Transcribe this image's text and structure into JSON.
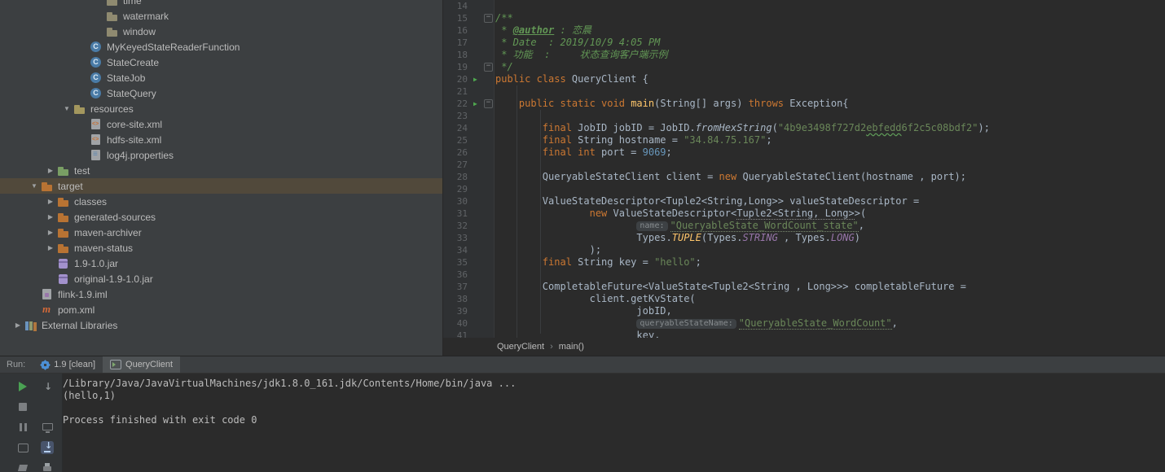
{
  "palette": {
    "editor_bg": "#2b2b2b",
    "panel_bg": "#3c3f41",
    "keyword": "#cc7832",
    "string": "#6a8759",
    "number": "#6897bb",
    "comment": "#629755",
    "method": "#ffc66b",
    "constant": "#9876aa",
    "tree_selection": "#51493b",
    "run_green": "#4aa153"
  },
  "project_tree": {
    "items": [
      {
        "label": "time",
        "type": "folder",
        "indent": 5
      },
      {
        "label": "watermark",
        "type": "folder",
        "indent": 5
      },
      {
        "label": "window",
        "type": "folder",
        "indent": 5
      },
      {
        "label": "MyKeyedStateReaderFunction",
        "type": "class",
        "indent": 4
      },
      {
        "label": "StateCreate",
        "type": "class",
        "indent": 4
      },
      {
        "label": "StateJob",
        "type": "class",
        "indent": 4
      },
      {
        "label": "StateQuery",
        "type": "class",
        "indent": 4
      },
      {
        "label": "resources",
        "type": "folder-resources",
        "indent": 3,
        "arrow": "down"
      },
      {
        "label": "core-site.xml",
        "type": "xml",
        "indent": 4
      },
      {
        "label": "hdfs-site.xml",
        "type": "xml",
        "indent": 4
      },
      {
        "label": "log4j.properties",
        "type": "properties",
        "indent": 4
      },
      {
        "label": "test",
        "type": "folder-test",
        "indent": 2,
        "arrow": "right"
      },
      {
        "label": "target",
        "type": "folder-excluded",
        "indent": 1,
        "arrow": "down",
        "selected": true
      },
      {
        "label": "classes",
        "type": "folder-gen",
        "indent": 2,
        "arrow": "right"
      },
      {
        "label": "generated-sources",
        "type": "folder-gen",
        "indent": 2,
        "arrow": "right"
      },
      {
        "label": "maven-archiver",
        "type": "folder-gen",
        "indent": 2,
        "arrow": "right"
      },
      {
        "label": "maven-status",
        "type": "folder-gen",
        "indent": 2,
        "arrow": "right"
      },
      {
        "label": "1.9-1.0.jar",
        "type": "jar",
        "indent": 2
      },
      {
        "label": "original-1.9-1.0.jar",
        "type": "jar",
        "indent": 2
      },
      {
        "label": "flink-1.9.iml",
        "type": "iml",
        "indent": 1
      },
      {
        "label": "pom.xml",
        "type": "maven",
        "indent": 1
      },
      {
        "label": "External Libraries",
        "type": "libs",
        "indent": 0,
        "arrow": "right"
      }
    ]
  },
  "editor": {
    "lines": [
      {
        "no": 14,
        "tokens": []
      },
      {
        "no": 15,
        "fold": true,
        "tokens": [
          [
            "d",
            "/**"
          ]
        ]
      },
      {
        "no": 16,
        "tokens": [
          [
            "d",
            " * "
          ],
          [
            "dt",
            "@author"
          ],
          [
            "d",
            " : 恋晨"
          ]
        ]
      },
      {
        "no": 17,
        "tokens": [
          [
            "d",
            " * Date  : 2019/10/9 4:05 PM"
          ]
        ]
      },
      {
        "no": 18,
        "tokens": [
          [
            "d",
            " * 功能  :     状态查询客户端示例"
          ]
        ]
      },
      {
        "no": 19,
        "fold": true,
        "tokens": [
          [
            "d",
            " */"
          ]
        ]
      },
      {
        "no": 20,
        "run": true,
        "tokens": [
          [
            "k",
            "public class "
          ],
          [
            "t",
            "QueryClient {"
          ]
        ]
      },
      {
        "no": 21,
        "tokens": []
      },
      {
        "no": 22,
        "run": true,
        "fold": true,
        "tokens": [
          [
            "t",
            "    "
          ],
          [
            "k",
            "public static void "
          ],
          [
            "m",
            "main"
          ],
          [
            "t",
            "(String[] args) "
          ],
          [
            "k",
            "throws"
          ],
          [
            "t",
            " Exception{"
          ]
        ]
      },
      {
        "no": 23,
        "tokens": []
      },
      {
        "no": 24,
        "tokens": [
          [
            "t",
            "        "
          ],
          [
            "k",
            "final "
          ],
          [
            "t",
            "JobID jobID = JobID."
          ],
          [
            "i",
            "fromHexString"
          ],
          [
            "t",
            "("
          ],
          [
            "s",
            "\"4b9e3498f727d2"
          ],
          [
            "sq",
            "ebfedd"
          ],
          [
            "s",
            "6f2c5c08bdf2\""
          ],
          [
            "t",
            ");"
          ]
        ]
      },
      {
        "no": 25,
        "tokens": [
          [
            "t",
            "        "
          ],
          [
            "k",
            "final "
          ],
          [
            "t",
            "String hostname = "
          ],
          [
            "s",
            "\"34.84.75.167\""
          ],
          [
            "t",
            ";"
          ]
        ]
      },
      {
        "no": 26,
        "tokens": [
          [
            "t",
            "        "
          ],
          [
            "k",
            "final int "
          ],
          [
            "t",
            "port = "
          ],
          [
            "n",
            "9069"
          ],
          [
            "t",
            ";"
          ]
        ]
      },
      {
        "no": 27,
        "tokens": []
      },
      {
        "no": 28,
        "tokens": [
          [
            "t",
            "        QueryableStateClient client = "
          ],
          [
            "k",
            "new "
          ],
          [
            "t",
            "QueryableStateClient(hostname , port);"
          ]
        ]
      },
      {
        "no": 29,
        "tokens": []
      },
      {
        "no": 30,
        "tokens": [
          [
            "t",
            "        ValueStateDescriptor<Tuple2<String,Long>> valueStateDescriptor ="
          ]
        ]
      },
      {
        "no": 31,
        "tokens": [
          [
            "t",
            "                "
          ],
          [
            "k",
            "new "
          ],
          [
            "t",
            "ValueStateDescriptor<"
          ],
          [
            "tu",
            "Tuple2<String, Long>"
          ],
          [
            "t",
            ">("
          ]
        ]
      },
      {
        "no": 32,
        "tokens": [
          [
            "t",
            "                        "
          ],
          [
            "hint",
            "name:"
          ],
          [
            "su",
            "\"QueryableState_WordCount_state\""
          ],
          [
            "t",
            ","
          ]
        ]
      },
      {
        "no": 33,
        "tokens": [
          [
            "t",
            "                        Types."
          ],
          [
            "sm",
            "TUPLE"
          ],
          [
            "t",
            "(Types."
          ],
          [
            "c",
            "STRING"
          ],
          [
            "t",
            " , Types."
          ],
          [
            "c",
            "LONG"
          ],
          [
            "t",
            ")"
          ]
        ]
      },
      {
        "no": 34,
        "tokens": [
          [
            "t",
            "                );"
          ]
        ]
      },
      {
        "no": 35,
        "tokens": [
          [
            "t",
            "        "
          ],
          [
            "k",
            "final "
          ],
          [
            "t",
            "String key = "
          ],
          [
            "s",
            "\"hello\""
          ],
          [
            "t",
            ";"
          ]
        ]
      },
      {
        "no": 36,
        "tokens": []
      },
      {
        "no": 37,
        "tokens": [
          [
            "t",
            "        CompletableFuture<ValueState<Tuple2<String , Long>>> completableFuture ="
          ]
        ]
      },
      {
        "no": 38,
        "tokens": [
          [
            "t",
            "                client.getKvState("
          ]
        ]
      },
      {
        "no": 39,
        "tokens": [
          [
            "t",
            "                        jobID,"
          ]
        ]
      },
      {
        "no": 40,
        "tokens": [
          [
            "t",
            "                        "
          ],
          [
            "hint",
            "queryableStateName:"
          ],
          [
            "su",
            "\"QueryableState_WordCount\""
          ],
          [
            "t",
            ","
          ]
        ]
      },
      {
        "no": 41,
        "tokens": [
          [
            "t",
            "                        key,"
          ]
        ]
      }
    ]
  },
  "breadcrumbs": {
    "items": [
      "QueryClient",
      "main()"
    ],
    "separator": "›"
  },
  "run_panel": {
    "label": "Run:",
    "tabs": [
      {
        "label": "1.9 [clean]",
        "icon": "run-config-gear-icon"
      },
      {
        "label": "QueryClient",
        "icon": "console-icon",
        "selected": true
      }
    ],
    "toolbar_icons": [
      {
        "name": "rerun-icon",
        "col": 0,
        "row": 0
      },
      {
        "name": "stop-icon",
        "col": 0,
        "row": 1
      },
      {
        "name": "pause-output-icon",
        "col": 0,
        "row": 2
      },
      {
        "name": "soft-wrap-icon",
        "col": 0,
        "row": 3
      },
      {
        "name": "clear-icon",
        "col": 0,
        "row": 4
      },
      {
        "name": "down-stack-icon",
        "col": 1,
        "row": 0
      },
      {
        "name": "monitor-icon",
        "col": 1,
        "row": 2
      },
      {
        "name": "scroll-to-end-icon",
        "col": 1,
        "row": 3,
        "active": true
      },
      {
        "name": "print-icon",
        "col": 1,
        "row": 4
      }
    ],
    "console_lines": [
      "/Library/Java/JavaVirtualMachines/jdk1.8.0_161.jdk/Contents/Home/bin/java ...",
      "(hello,1)",
      "",
      "Process finished with exit code 0"
    ]
  }
}
